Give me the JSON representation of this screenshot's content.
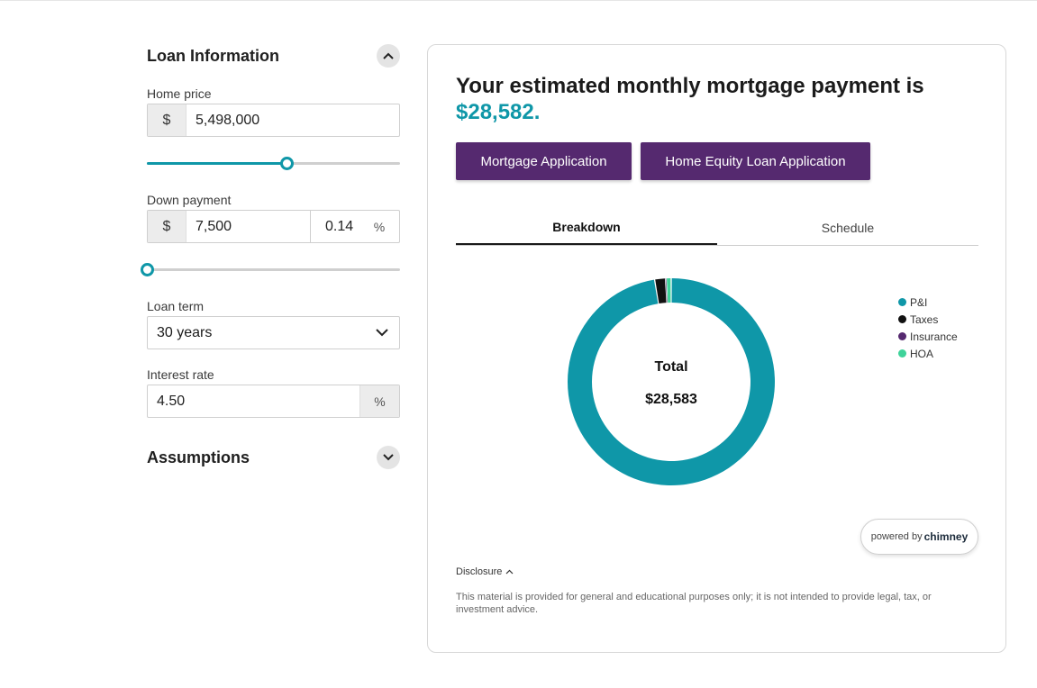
{
  "loan_info": {
    "title": "Loan Information",
    "home_price": {
      "label": "Home price",
      "prefix": "$",
      "value": "5,498,000",
      "slider_fraction": 0.55
    },
    "down_payment": {
      "label": "Down payment",
      "prefix": "$",
      "value": "7,500",
      "percent": "0.14",
      "suffix": "%",
      "slider_fraction": 0.0
    },
    "loan_term": {
      "label": "Loan term",
      "value": "30 years"
    },
    "interest_rate": {
      "label": "Interest rate",
      "value": "4.50",
      "suffix": "%"
    }
  },
  "assumptions": {
    "title": "Assumptions"
  },
  "result": {
    "headline": "Your estimated monthly mortgage payment is",
    "amount": "$28,582."
  },
  "buttons": {
    "mortgage": "Mortgage Application",
    "home_equity": "Home Equity Loan Application"
  },
  "tabs": [
    {
      "label": "Breakdown",
      "active": true
    },
    {
      "label": "Schedule",
      "active": false
    }
  ],
  "donut": {
    "center_label": "Total",
    "center_value": "$28,583"
  },
  "chart_data": {
    "type": "pie",
    "categories": [
      "P&I",
      "Taxes",
      "Insurance",
      "HOA"
    ],
    "values": [
      27850,
      480,
      30,
      223
    ],
    "colors": [
      "#0f97a8",
      "#111111",
      "#55296f",
      "#3fd39a"
    ],
    "legend_position": "right"
  },
  "powered_by": {
    "prefix": "powered by",
    "brand": "chimney"
  },
  "disclosure": {
    "label": "Disclosure",
    "text": "This material is provided for general and educational purposes only; it is not intended to provide legal, tax, or investment advice."
  },
  "colors": {
    "accent": "#0f97a8",
    "brand": "#55296f"
  }
}
